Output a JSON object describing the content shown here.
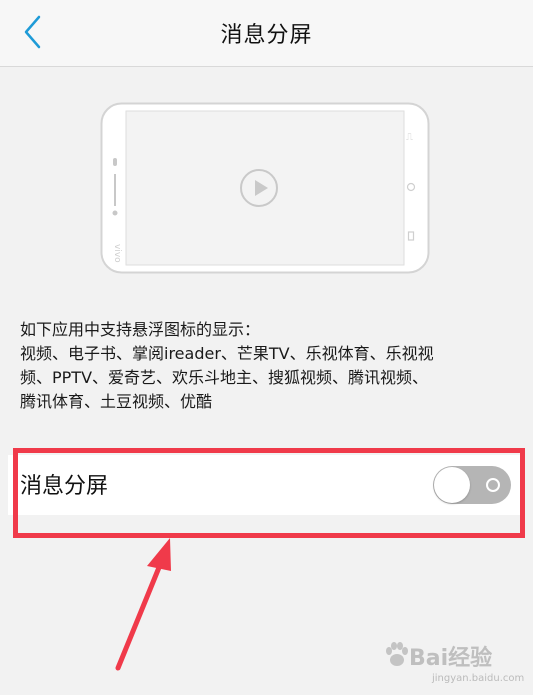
{
  "header": {
    "title": "消息分屏",
    "back_icon": "chevron-left-icon"
  },
  "illustration": {
    "icon": "play-icon"
  },
  "description": {
    "lines": [
      "如下应用中支持悬浮图标的显示：",
      "视频、电子书、掌阅ireader、芒果TV、乐视体育、乐视视",
      "频、PPTV、爱奇艺、欢乐斗地主、搜狐视频、腾讯视频、",
      "腾讯体育、土豆视频、优酷"
    ]
  },
  "setting": {
    "label": "消息分屏",
    "enabled": false
  },
  "annotation": {
    "highlight_color": "#f03a4a",
    "arrow_color": "#f03a4a"
  },
  "watermark": {
    "brand": "Bai经验",
    "url": "jingyan.baidu.com"
  },
  "colors": {
    "accent": "#1e9bd7",
    "toggle_off": "#b5b5b5"
  }
}
